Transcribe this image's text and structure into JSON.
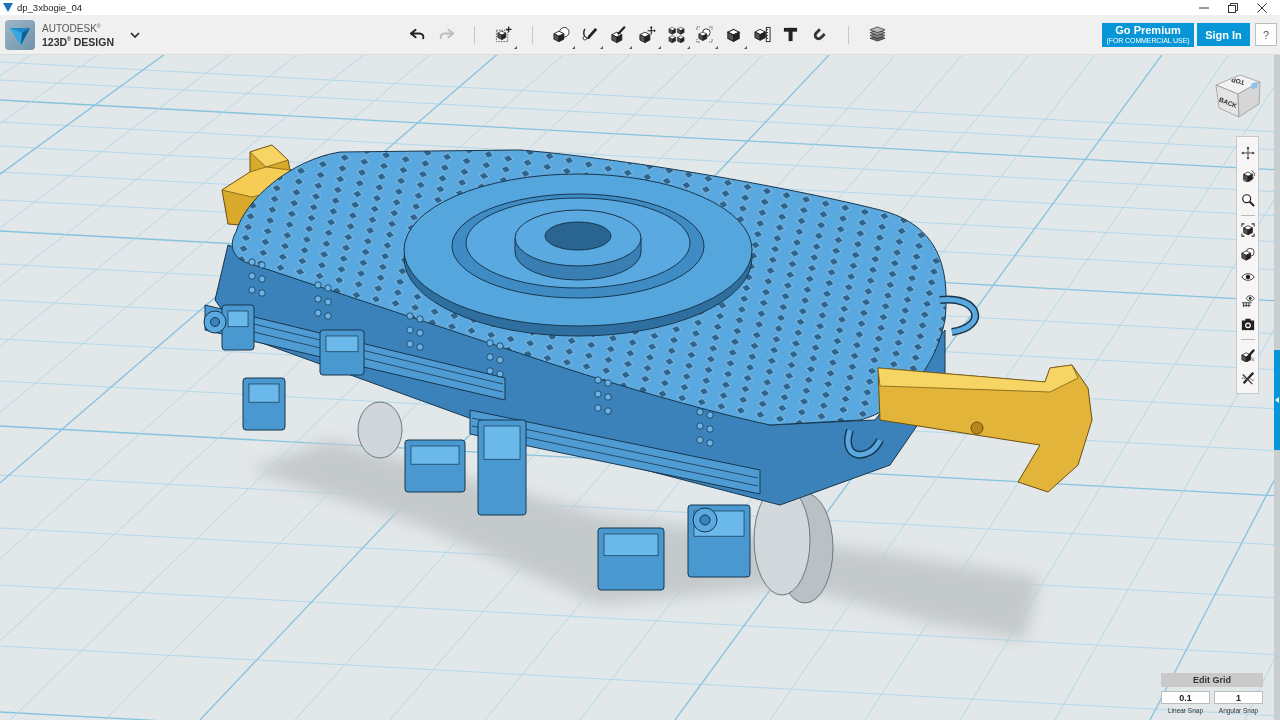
{
  "window": {
    "title": "dp_3xbogie_04"
  },
  "app_bar": {
    "brand": {
      "company": "AUTODESK$^{®}$",
      "product": "123D$^{®}$ DESIGN"
    },
    "history": [
      {
        "disabled": false
      },
      {
        "disabled": true
      }
    ],
    "tool_groups": [
      {
        "tools": [
          {
            "menu": true
          }
        ]
      },
      {
        "tools": [
          {
            "menu": true
          },
          {
            "menu": true
          },
          {
            "menu": true
          },
          {
            "menu": true
          },
          {
            "menu": true
          },
          {
            "menu": true
          },
          {
            "menu": true
          },
          {
            "menu": false
          },
          {
            "menu": false
          },
          {
            "menu": false
          }
        ]
      },
      {
        "tools": [
          {
            "menu": false
          }
        ]
      }
    ],
    "premium_button": {
      "label": "Go Premium",
      "note": "(FOR COMMERCIAL USE)"
    },
    "sign_in_button": {
      "label": "Sign In"
    },
    "help_button": {
      "label": "?"
    }
  },
  "view_cube": {
    "top_label": "TOP",
    "front_label": "BACK"
  },
  "grid_panel": {
    "title": "Edit Grid",
    "fields": [
      {
        "value": "0.1",
        "label": "Linear Snap"
      },
      {
        "value": "1",
        "label": "Angular Snap"
      }
    ]
  }
}
